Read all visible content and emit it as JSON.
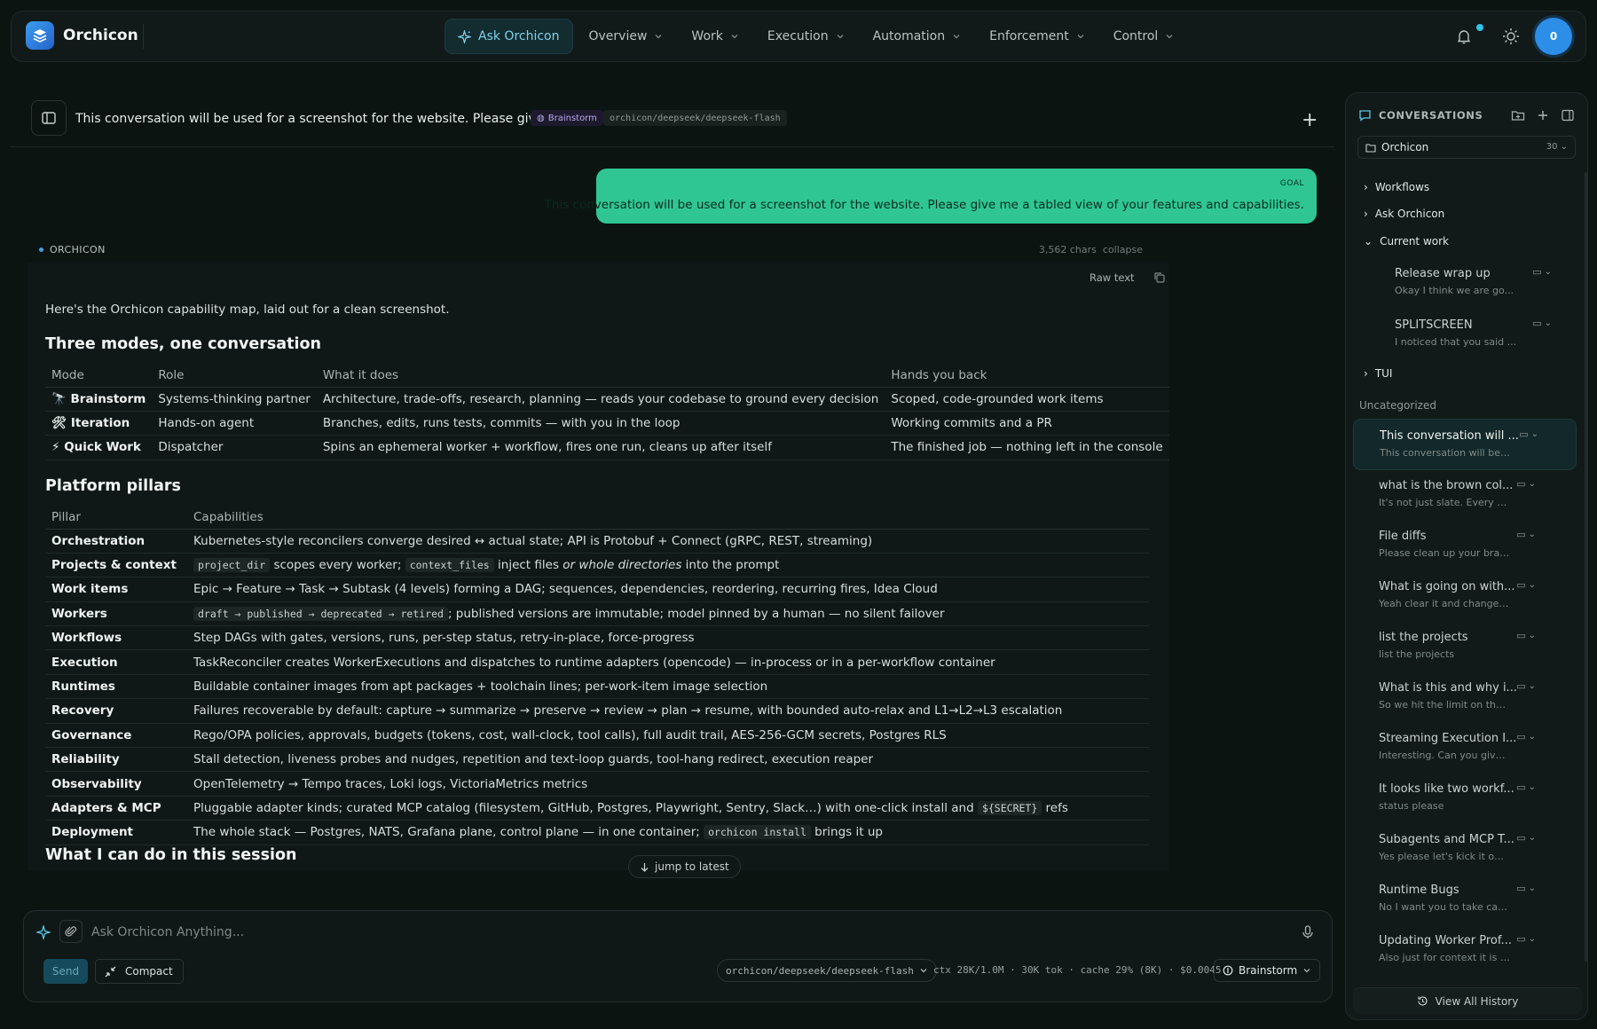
{
  "app": {
    "name": "Orchicon",
    "avatar_initial": "0"
  },
  "nav": {
    "ask": "Ask Orchicon",
    "items": [
      "Overview",
      "Work",
      "Execution",
      "Automation",
      "Enforcement",
      "Control"
    ]
  },
  "conversation": {
    "title": "This conversation will be used for a screenshot for the website. Please give me",
    "mode": "Brainstorm",
    "model": "orchicon/deepseek/deepseek-flash"
  },
  "goal": {
    "label": "GOAL",
    "text": "This conversation will be used for a screenshot for the website. Please give me a tabled view of your features and capabilities."
  },
  "response": {
    "author": "ORCHICON",
    "chars": "3,562 chars",
    "collapse": "collapse",
    "raw_text": "Raw text",
    "intro": "Here's the Orchicon capability map, laid out for a clean screenshot.",
    "section1": "Three modes, one conversation",
    "modes_headers": [
      "Mode",
      "Role",
      "What it does",
      "Hands you back"
    ],
    "modes": [
      {
        "emoji": "🔭",
        "mode": "Brainstorm",
        "role": "Systems-thinking partner",
        "does": "Architecture, trade-offs, research, planning — reads your codebase to ground every decision",
        "back": "Scoped, code-grounded work items"
      },
      {
        "emoji": "🛠",
        "mode": "Iteration",
        "role": "Hands-on agent",
        "does": "Branches, edits, runs tests, commits — with you in the loop",
        "back": "Working commits and a PR"
      },
      {
        "emoji": "⚡",
        "mode": "Quick Work",
        "role": "Dispatcher",
        "does": "Spins an ephemeral worker + workflow, fires one run, cleans up after itself",
        "back": "The finished job — nothing left in the console"
      }
    ],
    "section2": "Platform pillars",
    "pillars_headers": [
      "Pillar",
      "Capabilities"
    ],
    "pillars": [
      {
        "name": "Orchestration",
        "text": "Kubernetes-style reconcilers converge desired ↔ actual state; API is Protobuf + Connect (gRPC, REST, streaming)"
      },
      {
        "name": "Projects & context",
        "code1": "project_dir",
        "mid": " scopes every worker; ",
        "code2": "context_files",
        "after": " inject files ",
        "em": "or whole directories",
        "end": " into the prompt"
      },
      {
        "name": "Work items",
        "text": "Epic → Feature → Task → Subtask (4 levels) forming a DAG; sequences, dependencies, reordering, recurring fires, Idea Cloud"
      },
      {
        "name": "Workers",
        "code": "draft → published → deprecated → retired",
        "after": "; published versions are immutable; model pinned by a human — no silent failover"
      },
      {
        "name": "Workflows",
        "text": "Step DAGs with gates, versions, runs, per-step status, retry-in-place, force-progress"
      },
      {
        "name": "Execution",
        "text": "TaskReconciler creates WorkerExecutions and dispatches to runtime adapters (opencode) — in-process or in a per-workflow container"
      },
      {
        "name": "Runtimes",
        "text": "Buildable container images from apt packages + toolchain lines; per-work-item image selection"
      },
      {
        "name": "Recovery",
        "text": "Failures recoverable by default: capture → summarize → preserve → review → plan → resume, with bounded auto-relax and L1→L2→L3 escalation"
      },
      {
        "name": "Governance",
        "text": "Rego/OPA policies, approvals, budgets (tokens, cost, wall-clock, tool calls), full audit trail, AES-256-GCM secrets, Postgres RLS"
      },
      {
        "name": "Reliability",
        "text": "Stall detection, liveness probes and nudges, repetition and text-loop guards, tool-hang redirect, execution reaper"
      },
      {
        "name": "Observability",
        "text": "OpenTelemetry → Tempo traces, Loki logs, VictoriaMetrics metrics"
      },
      {
        "name": "Adapters & MCP",
        "before": "Pluggable adapter kinds; curated MCP catalog (filesystem, GitHub, Postgres, Playwright, Sentry, Slack…) with one-click install and ",
        "code": "${SECRET}",
        "after": " refs"
      },
      {
        "name": "Deployment",
        "before": "The whole stack — Postgres, NATS, Grafana plane, control plane — in one container; ",
        "code": "orchicon install",
        "after": " brings it up"
      }
    ],
    "section3": "What I can do in this session",
    "jump": "jump to latest"
  },
  "composer": {
    "placeholder": "Ask Orchicon Anything...",
    "send": "Send",
    "compact": "Compact",
    "model": "orchicon/deepseek/deepseek-flash",
    "stats": "ctx 28K/1.0M · 30K tok · cache 29% (8K) · $0.0045",
    "mode": "Brainstorm"
  },
  "sidebar": {
    "title": "CONVERSATIONS",
    "project": "Orchicon",
    "project_count": "30",
    "groups": {
      "workflows": "Workflows",
      "ask": "Ask Orchicon",
      "current": "Current work",
      "tui": "TUI"
    },
    "current_items": [
      {
        "title": "Release wrap up",
        "snippet": "Okay I think we are go..."
      },
      {
        "title": "SPLITSCREEN",
        "snippet": "I noticed that you said ..."
      }
    ],
    "uncategorized": "Uncategorized",
    "items": [
      {
        "title": "This conversation will ...",
        "snippet": "This conversation will be ..."
      },
      {
        "title": "what is the brown col...",
        "snippet": "It's not just slate. Every th..."
      },
      {
        "title": "File diffs",
        "snippet": "Please clean up your bran..."
      },
      {
        "title": "What is going on with...",
        "snippet": "Yeah clear it and change t..."
      },
      {
        "title": "list the projects",
        "snippet": "list the projects"
      },
      {
        "title": "What is this and why i...",
        "snippet": "So we hit the limit on the ..."
      },
      {
        "title": "Streaming Execution I...",
        "snippet": "Interesting. Can you give ..."
      },
      {
        "title": "It looks like two workf...",
        "snippet": "status please"
      },
      {
        "title": "Subagents and MCP T...",
        "snippet": "Yes please let's kick it off. ..."
      },
      {
        "title": "Runtime Bugs",
        "snippet": "No I want you to take car..."
      },
      {
        "title": "Updating Worker Prof...",
        "snippet": "Also just for context it is n..."
      }
    ],
    "view_all": "View All History"
  },
  "colors": {
    "goal": "#2fc693",
    "accent": "#2d8ee8",
    "background": "#0c1412"
  }
}
